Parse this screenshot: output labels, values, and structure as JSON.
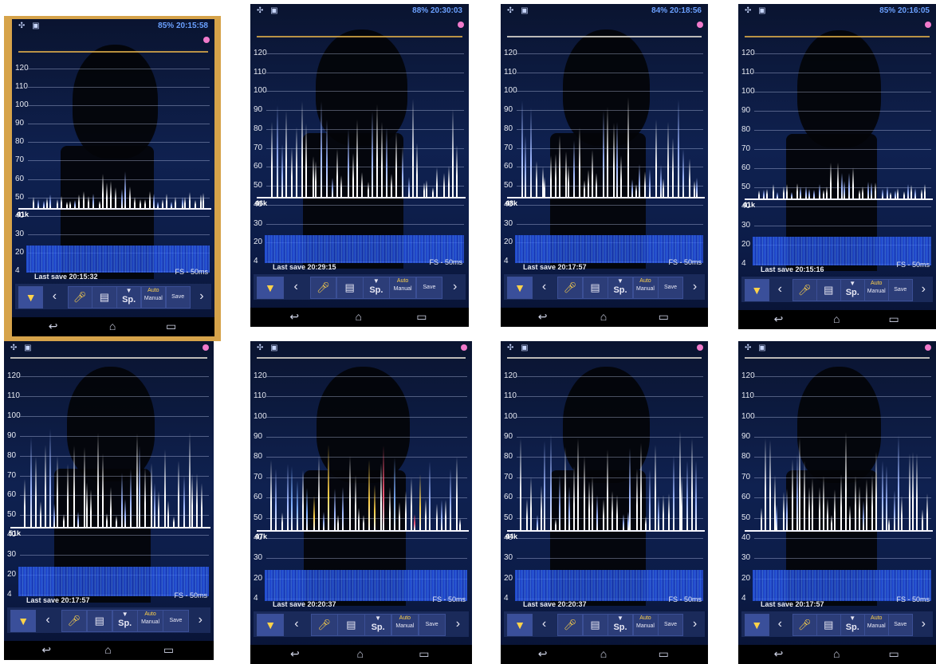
{
  "panels": [
    {
      "status_text": "85% 20:15:58",
      "last_save": "Last save 20:15:32",
      "freq_label": "41k",
      "fs_label": "FS - 50ms"
    },
    {
      "status_text": "88% 20:30:03",
      "last_save": "Last save 20:29:15",
      "freq_label": "46k",
      "fs_label": "FS - 50ms"
    },
    {
      "status_text": "84% 20:18:56",
      "last_save": "Last save 20:17:57",
      "freq_label": "48k",
      "fs_label": "FS - 50ms"
    },
    {
      "status_text": "85% 20:16:05",
      "last_save": "Last save 20:15:16",
      "freq_label": "41k",
      "fs_label": "FS - 50ms"
    },
    {
      "status_text": "",
      "last_save": "Last save 20:17:57",
      "freq_label": "51k",
      "fs_label": "FS - 50ms"
    },
    {
      "status_text": "",
      "last_save": "Last save 20:20:37",
      "freq_label": "47k",
      "fs_label": "FS - 50ms"
    },
    {
      "status_text": "",
      "last_save": "Last save 20:20:37",
      "freq_label": "44k",
      "fs_label": "FS - 50ms"
    },
    {
      "status_text": "",
      "last_save": "Last save 20:17:57",
      "freq_label": "",
      "fs_label": "FS - 50ms"
    }
  ],
  "axis_labels": [
    "120",
    "110",
    "100",
    "90",
    "80",
    "70",
    "60",
    "50",
    "40",
    "30",
    "20",
    "4"
  ],
  "toolbar": {
    "sp_label": "Sp.",
    "auto_label": "Auto",
    "manual_label": "Manual",
    "save_label": "Save",
    "back_glyph": "‹",
    "forward_glyph": "›"
  },
  "navbar": {
    "back_glyph": "↩",
    "home_glyph": "⌂",
    "recent_glyph": "▭"
  },
  "colors": {
    "background": "#020410",
    "spectrogram_band": "#2f66ff",
    "frequency_line": "#f5f5ff",
    "recording_dot": "#f07acb"
  }
}
